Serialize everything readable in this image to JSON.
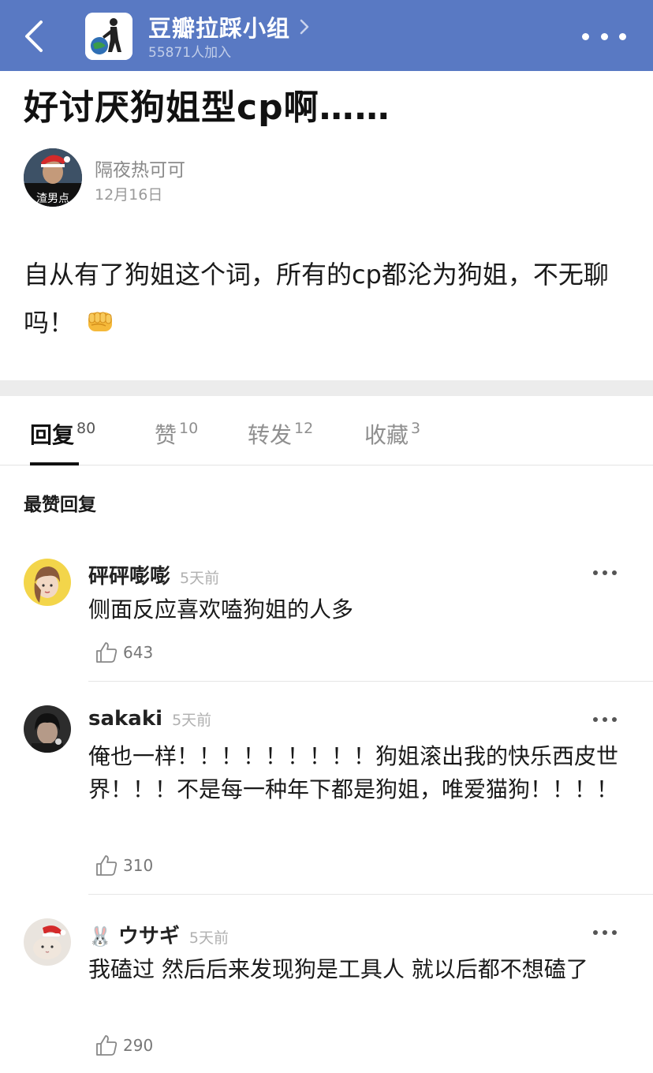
{
  "header": {
    "group_name": "豆瓣拉踩小组",
    "member_count": "55871人加入",
    "accent_color": "#5979c3",
    "icons": [
      "back-arrow-icon",
      "chevron-right-icon",
      "more-dots-icon"
    ]
  },
  "post": {
    "title": "好讨厌狗姐型cp啊……",
    "author": "隔夜热可可",
    "avatar_text": "渣男点",
    "date": "12月16日",
    "body": "自从有了狗姐这个词，所有的cp都沦为狗姐，不无聊吗！"
  },
  "tabs": [
    {
      "label": "回复",
      "count": "80"
    },
    {
      "label": "赞",
      "count": "10"
    },
    {
      "label": "转发",
      "count": "12"
    },
    {
      "label": "收藏",
      "count": "3"
    }
  ],
  "section_heading": "最赞回复",
  "comments": [
    {
      "name": "砰砰嘭嘭",
      "time": "5天前",
      "text": "侧面反应喜欢嗑狗姐的人多",
      "likes": "643"
    },
    {
      "name": "sakaki",
      "time": "5天前",
      "text": "俺也一样！！！！！！！！！狗姐滚出我的快乐西皮世界！！！不是每一种年下都是狗姐，唯爱猫狗！！！！",
      "likes": "310"
    },
    {
      "name": "ウサギ",
      "name_prefix_emoji": "🐰",
      "time": "5天前",
      "text": "我磕过 然后后来发现狗是工具人 就以后都不想磕了",
      "likes": "290"
    }
  ]
}
